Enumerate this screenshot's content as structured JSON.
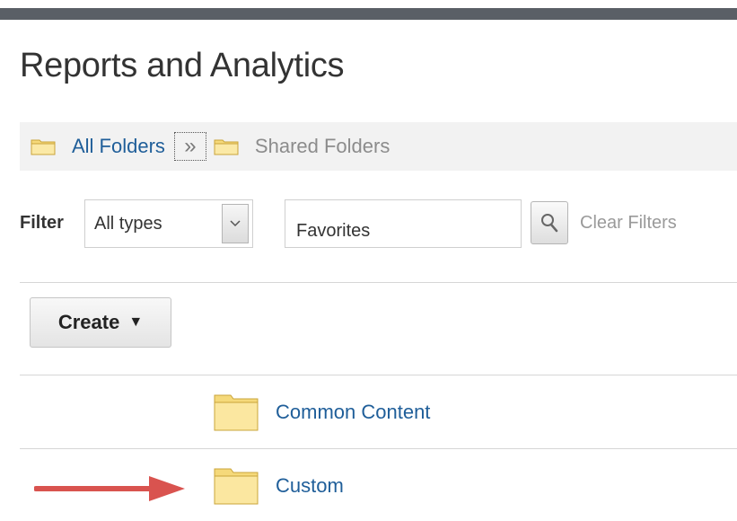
{
  "header": {
    "title": "Reports and Analytics"
  },
  "breadcrumb": {
    "root_label": "All Folders",
    "separator": "»",
    "current_label": "Shared Folders"
  },
  "filter": {
    "label": "Filter",
    "type_value": "All types",
    "search_value": "Favorites",
    "clear_label": "Clear Filters"
  },
  "toolbar": {
    "create_label": "Create",
    "create_caret": "▼"
  },
  "folders": [
    {
      "name": "Common Content",
      "icon": "folder-icon"
    },
    {
      "name": "Custom",
      "icon": "folder-icon"
    }
  ],
  "colors": {
    "link": "#1f5e99",
    "folder": "#f7e08a",
    "arrow": "#d9534f"
  }
}
